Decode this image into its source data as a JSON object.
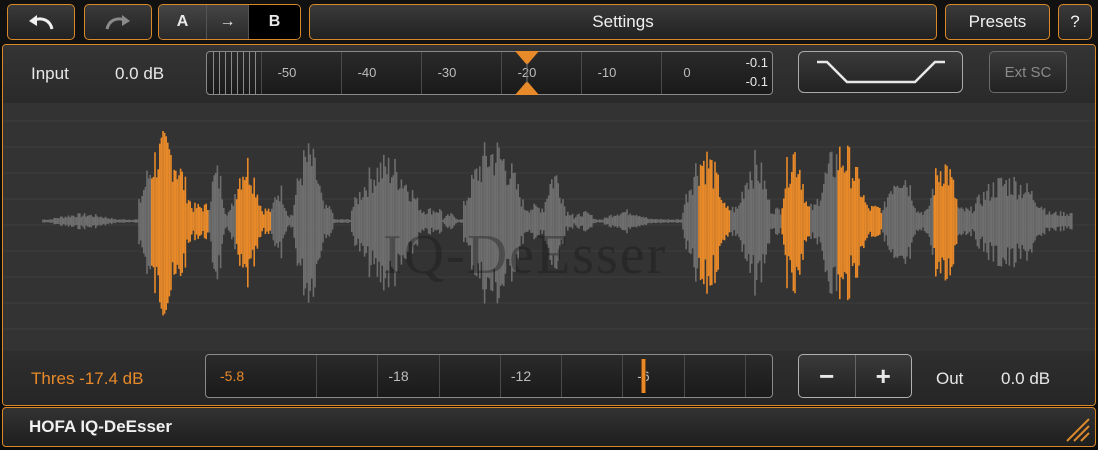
{
  "toolbar": {
    "undo_icon": "undo-arrow-icon",
    "redo_icon": "redo-arrow-icon",
    "ab_a": "A",
    "ab_arrow": "→",
    "ab_b": "B",
    "settings": "Settings",
    "presets": "Presets",
    "help": "?"
  },
  "input": {
    "label": "Input",
    "value": "0.0 dB",
    "scale": [
      "-50",
      "-40",
      "-30",
      "-20",
      "-10",
      "0"
    ],
    "peak_top": "-0.1",
    "peak_bottom": "-0.1",
    "marker_db": -20
  },
  "filter_icon": "band-filter-curve-icon",
  "ext_sc": "Ext SC",
  "watermark": "IQ-DeEsser",
  "threshold": {
    "label": "Thres -17.4 dB",
    "current": "-5.8",
    "scale": [
      "-18",
      "-12",
      "-6"
    ],
    "marker_db": -6
  },
  "output": {
    "minus": "−",
    "plus": "+",
    "label": "Out",
    "value": "0.0 dB"
  },
  "footer": {
    "title": "HOFA IQ-DeEsser"
  },
  "colors": {
    "accent": "#d9892a",
    "waveform_gray": "#6e6e6e",
    "waveform_orange": "#e88a2a"
  }
}
